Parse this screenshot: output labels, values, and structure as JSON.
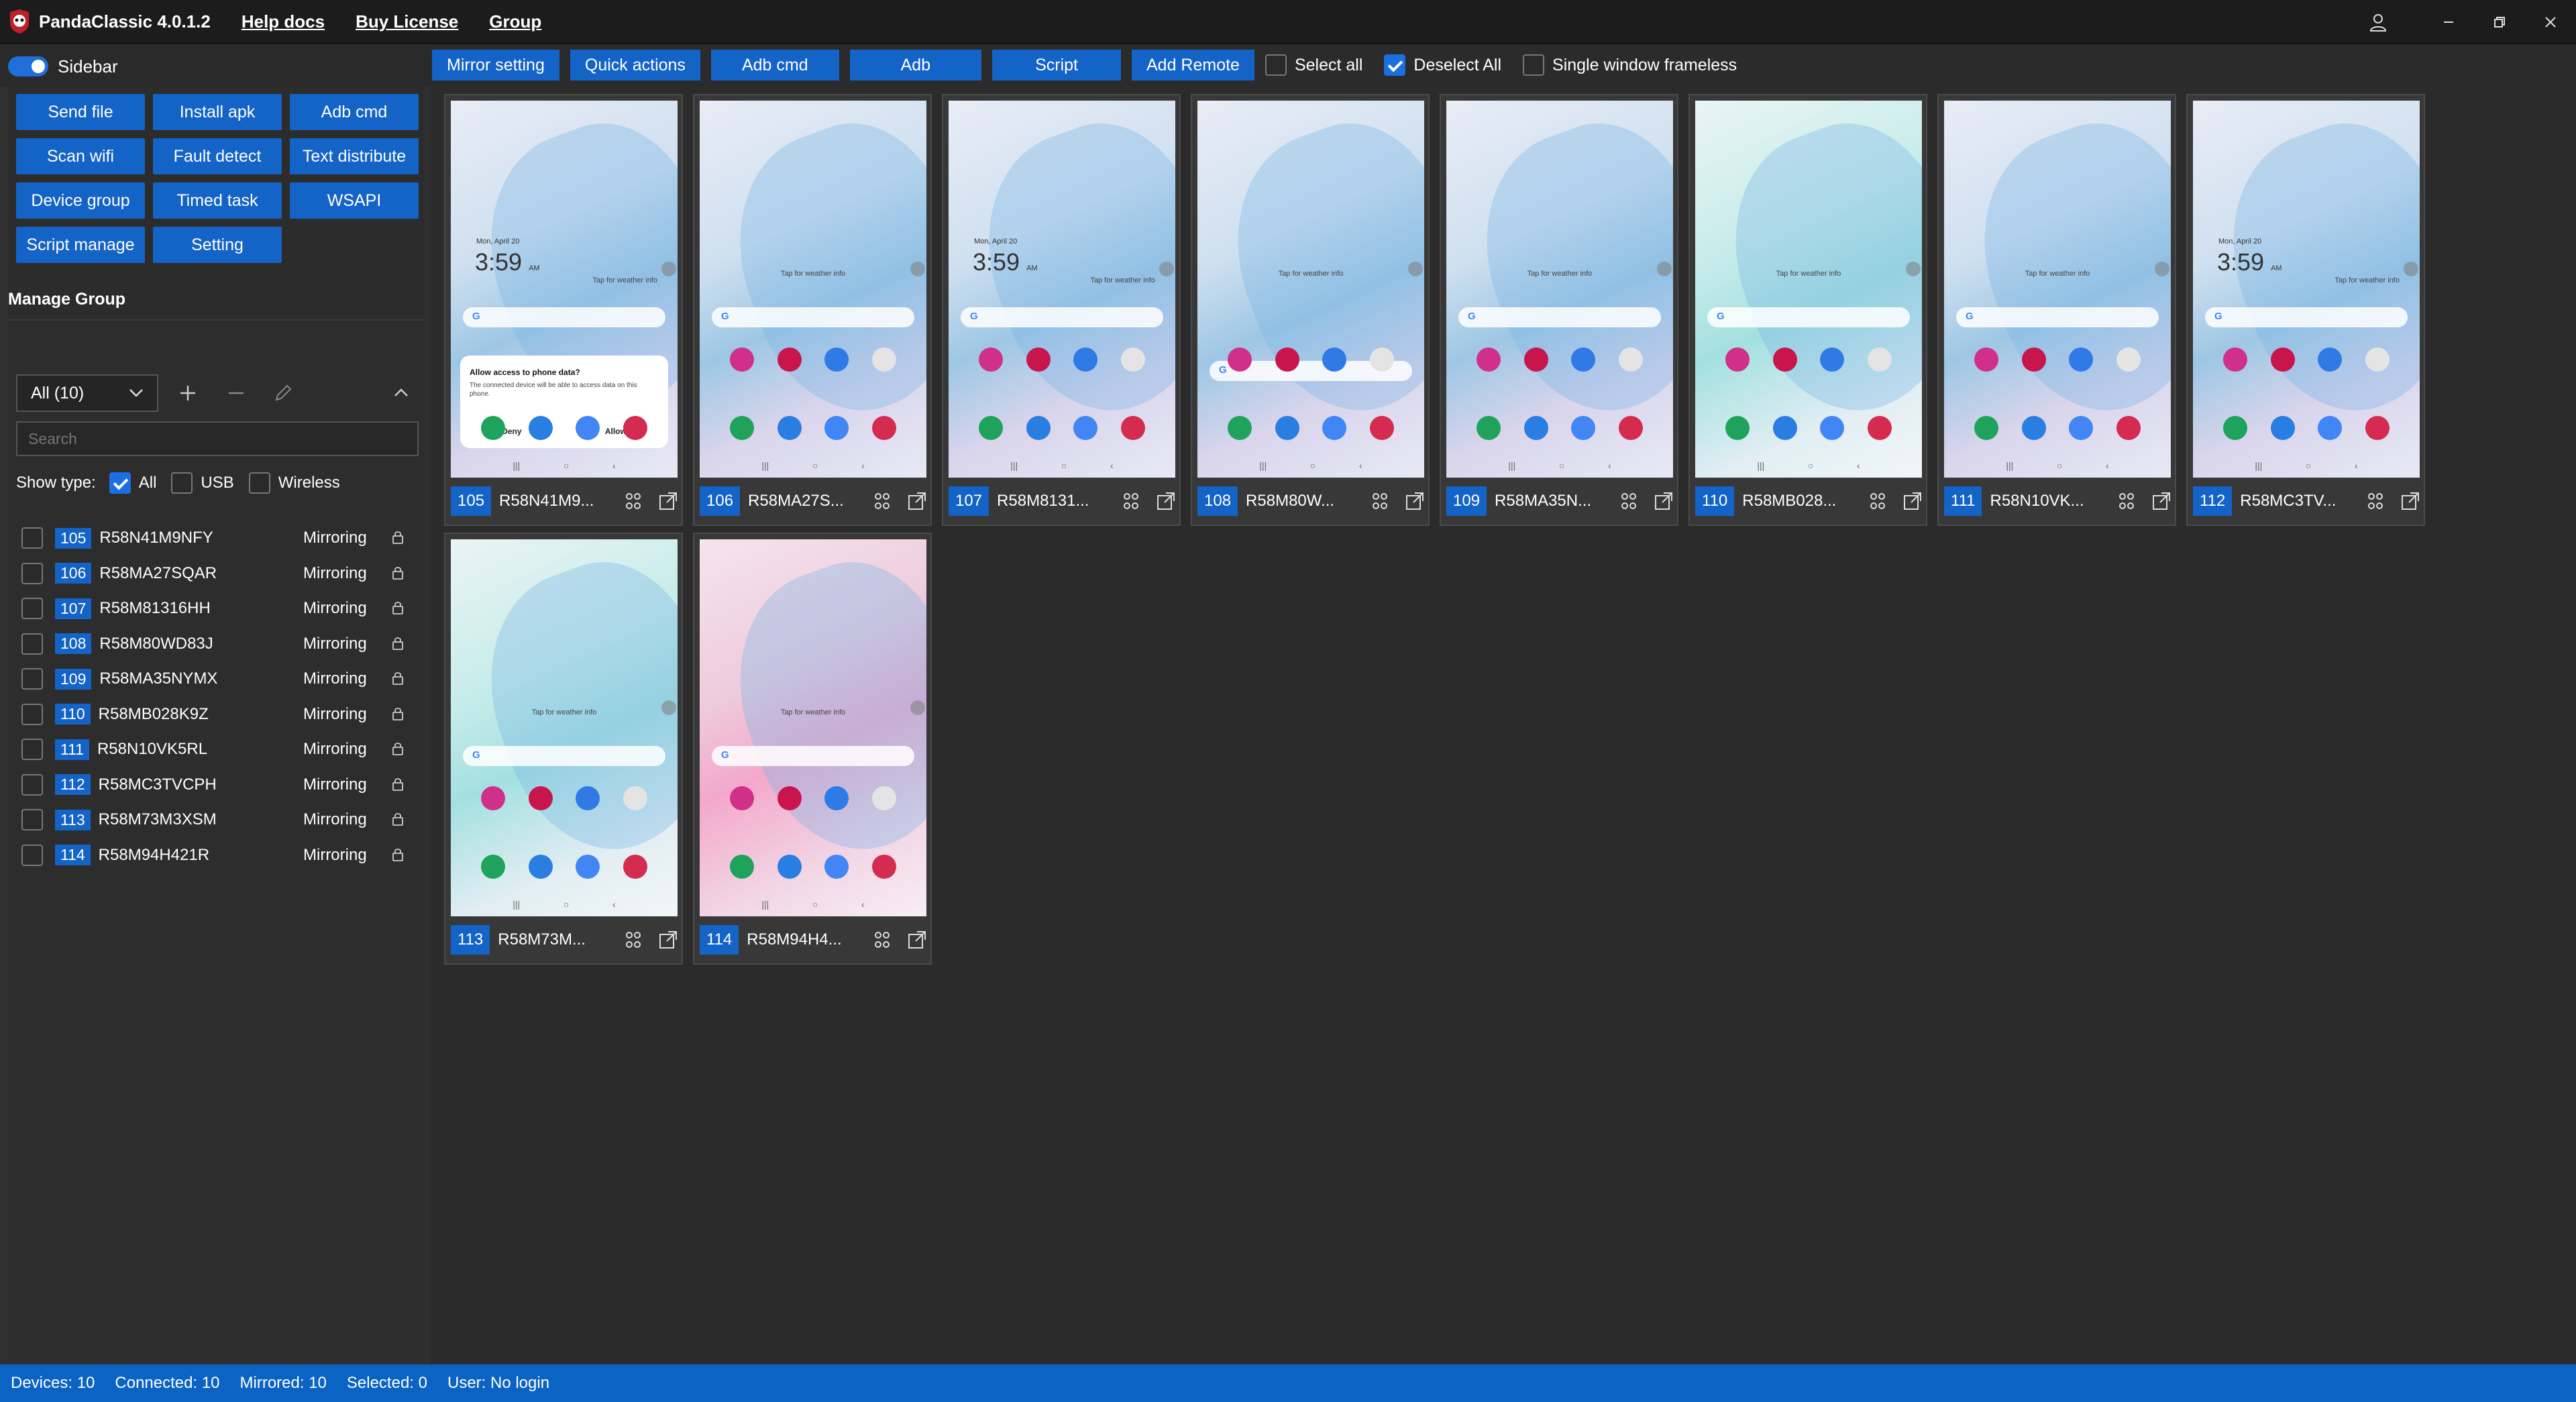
{
  "app": {
    "title": "PandaClassic 4.0.1.2",
    "menu": [
      "Help docs",
      "Buy License",
      "Group"
    ]
  },
  "sidebar": {
    "toggle_label": "Sidebar",
    "tools": [
      "Send file",
      "Install apk",
      "Adb cmd",
      "Scan wifi",
      "Fault detect",
      "Text distribute",
      "Device group",
      "Timed task",
      "WSAPI",
      "Script manage",
      "Setting"
    ],
    "manage_title": "Manage Group",
    "group_select": "All (10)",
    "search_placeholder": "Search",
    "show_type_label": "Show type:",
    "show_types": [
      {
        "label": "All",
        "checked": true
      },
      {
        "label": "USB",
        "checked": false
      },
      {
        "label": "Wireless",
        "checked": false
      }
    ],
    "devices": [
      {
        "num": "105",
        "serial": "R58N41M9NFY",
        "status": "Mirroring"
      },
      {
        "num": "106",
        "serial": "R58MA27SQAR",
        "status": "Mirroring"
      },
      {
        "num": "107",
        "serial": "R58M81316HH",
        "status": "Mirroring"
      },
      {
        "num": "108",
        "serial": "R58M80WD83J",
        "status": "Mirroring"
      },
      {
        "num": "109",
        "serial": "R58MA35NYMX",
        "status": "Mirroring"
      },
      {
        "num": "110",
        "serial": "R58MB028K9Z",
        "status": "Mirroring"
      },
      {
        "num": "111",
        "serial": "R58N10VK5RL",
        "status": "Mirroring"
      },
      {
        "num": "112",
        "serial": "R58MC3TVCPH",
        "status": "Mirroring"
      },
      {
        "num": "113",
        "serial": "R58M73M3XSM",
        "status": "Mirroring"
      },
      {
        "num": "114",
        "serial": "R58M94H421R",
        "status": "Mirroring"
      }
    ]
  },
  "toolbar": {
    "buttons": [
      "Mirror setting",
      "Quick actions",
      "Adb cmd",
      "Adb",
      "Script",
      "Add Remote"
    ],
    "select_all": "Select all",
    "deselect_all": "Deselect All",
    "single_frameless": "Single window frameless"
  },
  "cards": [
    {
      "num": "105",
      "name": "R58N41M9...",
      "theme": "blue",
      "lock": true,
      "dialog": true
    },
    {
      "num": "106",
      "name": "R58MA27S...",
      "theme": "blue",
      "lock": false
    },
    {
      "num": "107",
      "name": "R58M8131...",
      "theme": "blue",
      "lock": true
    },
    {
      "num": "108",
      "name": "R58M80W...",
      "theme": "blue",
      "lock": false
    },
    {
      "num": "109",
      "name": "R58MA35N...",
      "theme": "blue",
      "lock": false
    },
    {
      "num": "110",
      "name": "R58MB028...",
      "theme": "teal",
      "lock": false
    },
    {
      "num": "111",
      "name": "R58N10VK...",
      "theme": "blue",
      "lock": false
    },
    {
      "num": "112",
      "name": "R58MC3TV...",
      "theme": "blue",
      "lock": true
    },
    {
      "num": "113",
      "name": "R58M73M...",
      "theme": "teal",
      "lock": false
    },
    {
      "num": "114",
      "name": "R58M94H4...",
      "theme": "pink",
      "lock": false
    }
  ],
  "phone": {
    "date": "Mon, April 20",
    "time": "3:59",
    "ampm": "AM",
    "weather_tap": "Tap for weather info",
    "dialog_title": "Allow access to phone data?",
    "dialog_body": "The connected device will be able to access data on this phone.",
    "deny": "Deny",
    "allow": "Allow"
  },
  "status": {
    "devices": "Devices: 10",
    "connected": "Connected: 10",
    "mirrored": "Mirrored: 10",
    "selected": "Selected: 0",
    "user": "User: No login"
  },
  "colors": {
    "accent": "#1463c6",
    "statusbar": "#0b63c4",
    "background": "#2b2b2b"
  }
}
